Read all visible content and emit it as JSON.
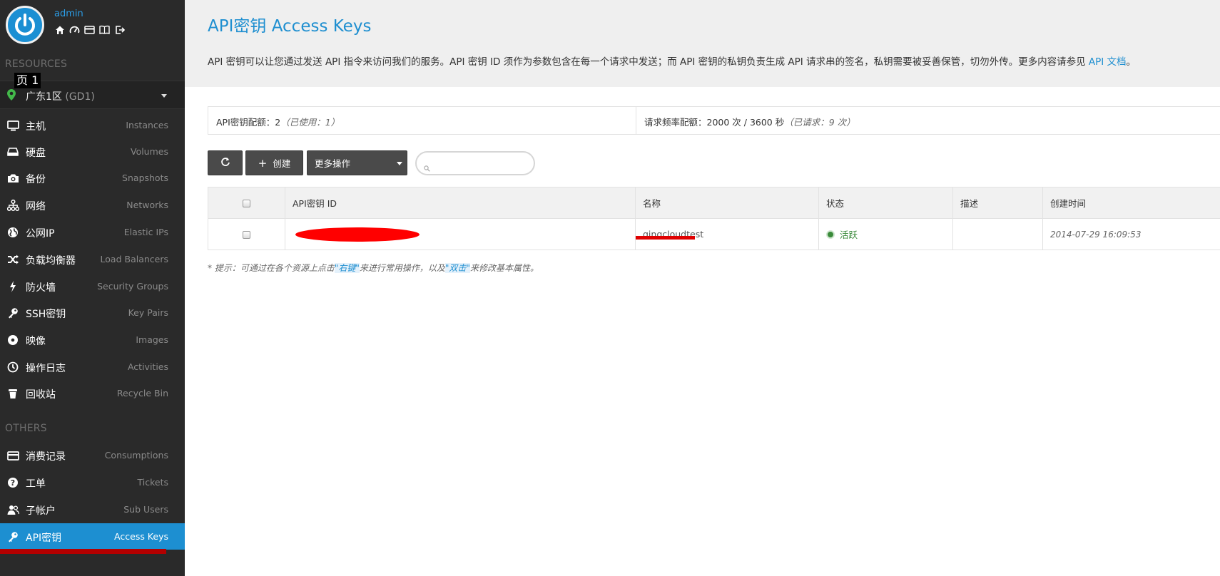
{
  "user": {
    "name": "admin"
  },
  "overlay_tag": "页 1",
  "sections": {
    "resources": "RESOURCES",
    "others": "OTHERS"
  },
  "region": {
    "name": "广东1区",
    "code": "(GD1)"
  },
  "nav": [
    {
      "cn": "主机",
      "en": "Instances",
      "icon": "monitor-icon"
    },
    {
      "cn": "硬盘",
      "en": "Volumes",
      "icon": "disk-icon"
    },
    {
      "cn": "备份",
      "en": "Snapshots",
      "icon": "camera-icon"
    },
    {
      "cn": "网络",
      "en": "Networks",
      "icon": "network-icon"
    },
    {
      "cn": "公网IP",
      "en": "Elastic IPs",
      "icon": "globe-icon"
    },
    {
      "cn": "负载均衡器",
      "en": "Load Balancers",
      "icon": "shuffle-icon"
    },
    {
      "cn": "防火墙",
      "en": "Security Groups",
      "icon": "bolt-icon"
    },
    {
      "cn": "SSH密钥",
      "en": "Key Pairs",
      "icon": "key-icon"
    },
    {
      "cn": "映像",
      "en": "Images",
      "icon": "disc-icon"
    },
    {
      "cn": "操作日志",
      "en": "Activities",
      "icon": "clock-icon"
    },
    {
      "cn": "回收站",
      "en": "Recycle Bin",
      "icon": "trash-icon"
    }
  ],
  "nav_others": [
    {
      "cn": "消费记录",
      "en": "Consumptions",
      "icon": "card-icon"
    },
    {
      "cn": "工单",
      "en": "Tickets",
      "icon": "question-icon"
    },
    {
      "cn": "子帐户",
      "en": "Sub Users",
      "icon": "users-icon"
    },
    {
      "cn": "API密钥",
      "en": "Access Keys",
      "icon": "key-icon",
      "active": true
    }
  ],
  "page": {
    "title": "API密钥 Access Keys",
    "description": "API 密钥可以让您通过发送 API 指令来访问我们的服务。API 密钥 ID 须作为参数包含在每一个请求中发送；而 API 密钥的私钥负责生成 API 请求串的签名，私钥需要被妥善保管，切勿外传。更多内容请参见 ",
    "doc_link": "API 文档",
    "desc_end": "。"
  },
  "quota": {
    "left_label": "API密钥配额：2",
    "left_note": "（已使用：1）",
    "right_label": "请求频率配额：2000 次 / 3600 秒",
    "right_note": "（已请求：9 次）"
  },
  "toolbar": {
    "create_label": "创建",
    "more_label": "更多操作",
    "search_value": ""
  },
  "table": {
    "headers": [
      "API密钥 ID",
      "名称",
      "状态",
      "描述",
      "创建时间"
    ],
    "rows": [
      {
        "name": "qingcloudtest",
        "status": "活跃",
        "description": "",
        "created": "2014-07-29 16:09:53"
      }
    ]
  },
  "tip": {
    "t1": "* 提示：可通过在各个资源上点击",
    "h1": "\"右键\"",
    "t2": "来进行常用操作，以及",
    "h2": "\"双击\"",
    "t3": "来修改基本属性。"
  },
  "colors": {
    "accent": "#1f8fd0",
    "sidebar": "#2a2a2a",
    "active": "#1d8fd1",
    "status_ok": "#3a8a3a",
    "redaction": "#ff0000"
  }
}
